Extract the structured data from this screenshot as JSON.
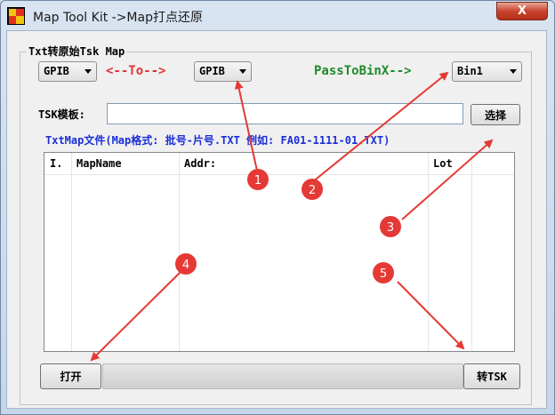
{
  "window": {
    "title": "Map Tool Kit ->Map打点还原",
    "close_glyph": "X"
  },
  "group": {
    "legend": "Txt转原始Tsk Map"
  },
  "controls": {
    "combo_from": "GPIB",
    "to_label": "<--To-->",
    "combo_to": "GPIB",
    "pass_label": "PassToBinX-->",
    "combo_bin": "Bin1",
    "tsk_label": "TSK模板:",
    "tsk_value": "",
    "select_button": "选择",
    "hint": "TxtMap文件(Map格式: 批号-片号.TXT 例如: FA01-1111-01.TXT)",
    "open_button": "打开",
    "convert_button": "转TSK",
    "progress_fraction": 0
  },
  "table": {
    "columns": [
      "I.",
      "MapName",
      "Addr:",
      "Lot"
    ],
    "rows": []
  },
  "annotations": {
    "color": "#e53935",
    "markers": [
      "1",
      "2",
      "3",
      "4",
      "5"
    ]
  }
}
